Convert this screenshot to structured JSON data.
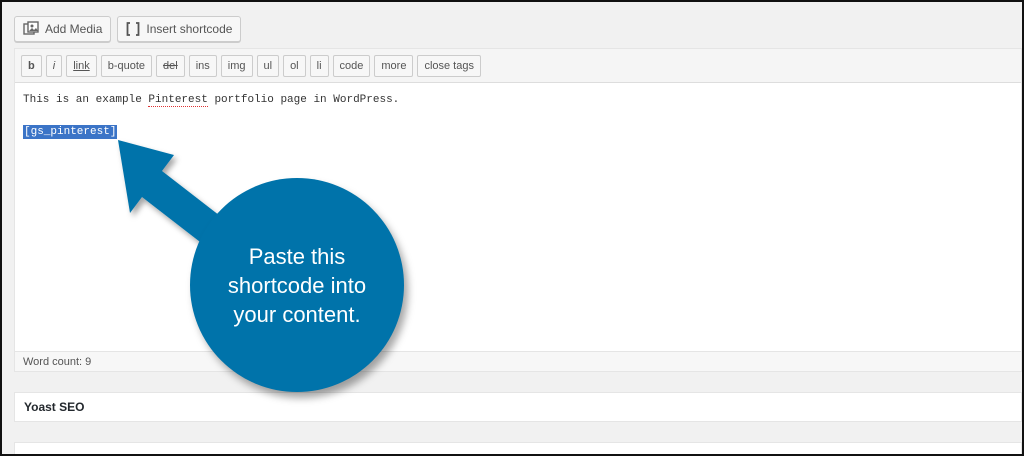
{
  "toolbar": {
    "add_media": "Add Media",
    "insert_shortcode": "Insert shortcode"
  },
  "quicktags": [
    "b",
    "i",
    "link",
    "b-quote",
    "del",
    "ins",
    "img",
    "ul",
    "ol",
    "li",
    "code",
    "more",
    "close tags"
  ],
  "editor": {
    "line1": {
      "before": "This is an example ",
      "misspelled": "Pinterest",
      "after": " portfolio page in WordPress."
    },
    "shortcode": "[gs_pinterest]"
  },
  "status": {
    "word_count": "Word count: 9"
  },
  "panels": {
    "yoast": "Yoast SEO"
  },
  "callout": {
    "text": "Paste this shortcode into your content."
  },
  "colors": {
    "accent": "#0073aa",
    "selection": "#3b74c7"
  }
}
